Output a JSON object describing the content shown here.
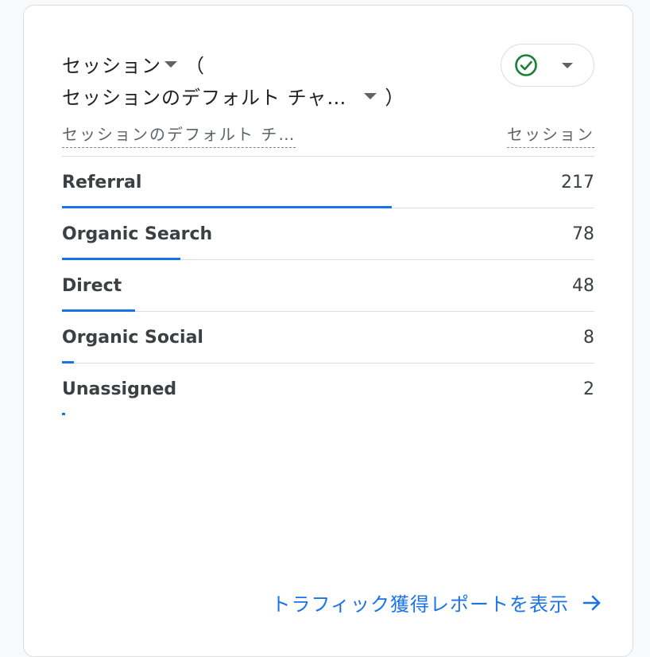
{
  "card": {
    "title_metric": "セッション",
    "paren_open": "（",
    "title_dimension": "セッションのデフォルト チャ…",
    "paren_close": "）",
    "status_icon": "check-circle-icon",
    "status_color": "#188038"
  },
  "table": {
    "col_dimension": "セッションのデフォルト チ…",
    "col_metric": "セッション",
    "max_value": 217,
    "rows": [
      {
        "label": "Referral",
        "value": "217",
        "num": 217
      },
      {
        "label": "Organic Search",
        "value": "78",
        "num": 78
      },
      {
        "label": "Direct",
        "value": "48",
        "num": 48
      },
      {
        "label": "Organic Social",
        "value": "8",
        "num": 8
      },
      {
        "label": "Unassigned",
        "value": "2",
        "num": 2
      }
    ]
  },
  "footer": {
    "link_text": "トラフィック獲得レポートを表示",
    "link_icon": "arrow-right-icon"
  },
  "colors": {
    "accent": "#1a73e8",
    "bar": "#1a73e8"
  }
}
